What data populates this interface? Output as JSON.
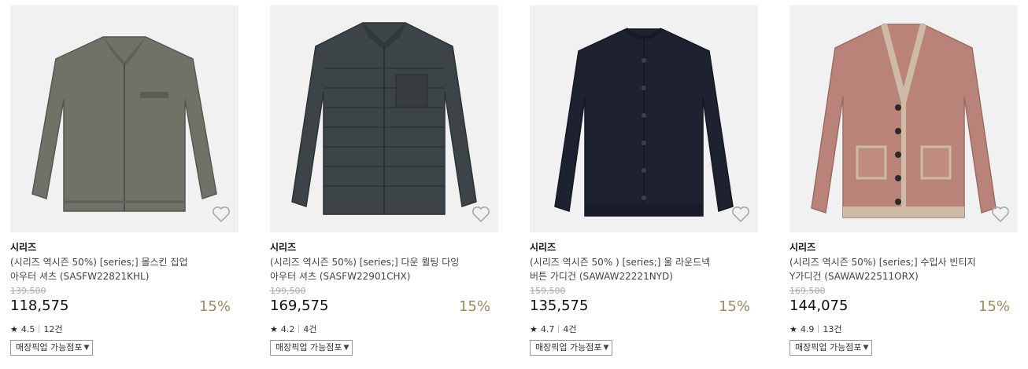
{
  "products": [
    {
      "brand": "시리즈",
      "name": "(시리즈 역시즌 50%) [series;] 몰스킨 집업 아우터 셔츠 (SASFW22821KHL)",
      "original_price": "139,500",
      "sale_price": "118,575",
      "discount": "15%",
      "rating": "4.5",
      "reviews": "12건",
      "pickup_label": "매장픽업 가능점포",
      "image_icon": "zip-shirt-jacket",
      "garment_color": "#6f7266",
      "wishlist_icon": "heart-icon"
    },
    {
      "brand": "시리즈",
      "name": "(시리즈 역시즌 50%) [series;] 다운 퀼팅 다잉 아우터 셔츠 (SASFW22901CHX)",
      "original_price": "199,500",
      "sale_price": "169,575",
      "discount": "15%",
      "rating": "4.2",
      "reviews": "4건",
      "pickup_label": "매장픽업 가능점포",
      "image_icon": "quilted-down-shirt",
      "garment_color": "#3d4447",
      "wishlist_icon": "heart-icon"
    },
    {
      "brand": "시리즈",
      "name": "(시리즈 역시즌 50% ) [series;] 울 라운드넥 버튼 가디건 (SAWAW22221NYD)",
      "original_price": "159,500",
      "sale_price": "135,575",
      "discount": "15%",
      "rating": "4.7",
      "reviews": "4건",
      "pickup_label": "매장픽업 가능점포",
      "image_icon": "round-neck-cardigan",
      "garment_color": "#1e2230",
      "wishlist_icon": "heart-icon"
    },
    {
      "brand": "시리즈",
      "name": "(시리즈 역시즌 50%) [series;] 수입사 빈티지 Y가디건 (SAWAW22511ORX)",
      "original_price": "169,500",
      "sale_price": "144,075",
      "discount": "15%",
      "rating": "4.9",
      "reviews": "13건",
      "pickup_label": "매장픽업 가능점포",
      "image_icon": "v-neck-cardigan",
      "garment_color": "#b9837a",
      "wishlist_icon": "heart-icon"
    }
  ]
}
